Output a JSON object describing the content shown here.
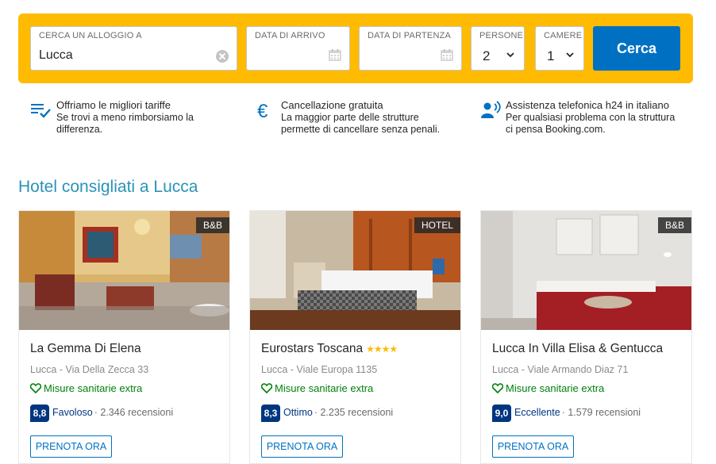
{
  "search": {
    "dest_label": "CERCA UN ALLOGGIO A",
    "dest_value": "Lucca",
    "checkin_label": "DATA DI ARRIVO",
    "checkout_label": "DATA DI PARTENZA",
    "persons_label": "PERSONE",
    "persons_value": "2",
    "rooms_label": "CAMERE",
    "rooms_value": "1",
    "submit_label": "Cerca"
  },
  "benefits": [
    {
      "icon": "list-check-icon",
      "title": "Offriamo le migliori tariffe",
      "line1": "Se trovi a meno rimborsiamo la",
      "line2": "differenza."
    },
    {
      "icon": "euro-icon",
      "title": "Cancellazione gratuita",
      "line1": "La maggior parte delle strutture",
      "line2": "permette di cancellare senza penali."
    },
    {
      "icon": "phone-support-icon",
      "title": "Assistenza telefonica h24 in italiano",
      "line1": "Per qualsiasi problema con la struttura",
      "line2": "ci pensa Booking.com."
    }
  ],
  "section_title": "Hotel consigliati a Lucca",
  "hotels": [
    {
      "type": "B&B",
      "name": "La Gemma Di Elena",
      "stars": "",
      "address": "Lucca - Via Della Zecca 33",
      "health": "Misure sanitarie extra",
      "score": "8,8",
      "score_word": "Favoloso",
      "reviews": "· 2.346 recensioni",
      "cta": "PRENOTA ORA"
    },
    {
      "type": "HOTEL",
      "name": "Eurostars Toscana",
      "stars": "★★★★",
      "address": "Lucca - Viale Europa 1135",
      "health": "Misure sanitarie extra",
      "score": "8,3",
      "score_word": "Ottimo",
      "reviews": "· 2.235 recensioni",
      "cta": "PRENOTA ORA"
    },
    {
      "type": "B&B",
      "name": "Lucca In Villa Elisa & Gentucca",
      "stars": "",
      "address": "Lucca - Viale Armando Diaz 71",
      "health": "Misure sanitarie extra",
      "score": "9,0",
      "score_word": "Eccellente",
      "reviews": "· 1.579 recensioni",
      "cta": "PRENOTA ORA"
    }
  ],
  "colors": {
    "brand_yellow": "#febb02",
    "brand_blue": "#0071c2",
    "score_navy": "#003580",
    "health_green": "#008009",
    "title_teal": "#2a93b8"
  }
}
